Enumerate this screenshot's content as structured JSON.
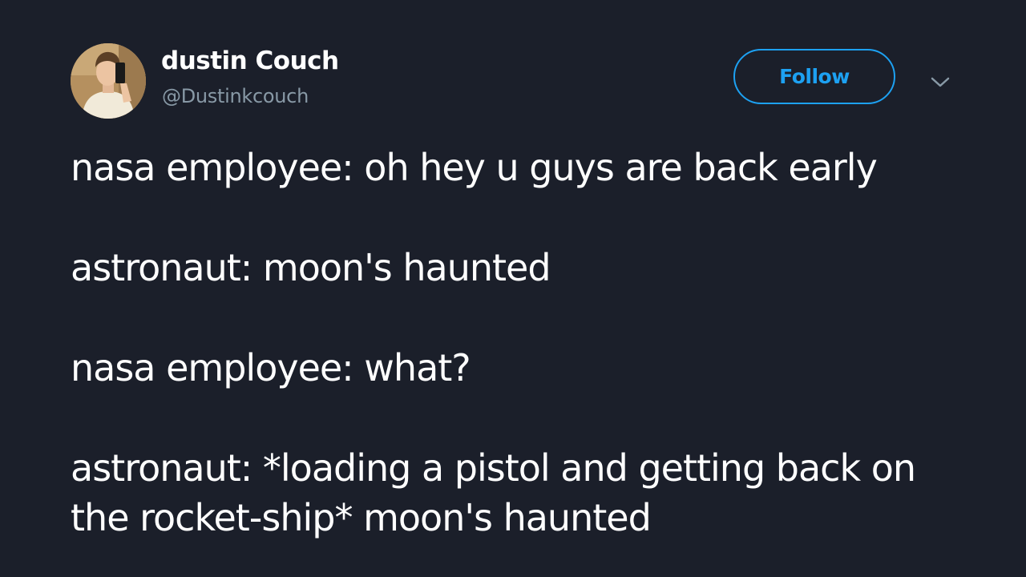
{
  "author": {
    "display_name": "dustin Couch",
    "handle": "@Dustinkcouch"
  },
  "actions": {
    "follow_label": "Follow",
    "more_icon": "chevron-down-icon"
  },
  "tweet": {
    "lines": [
      "nasa employee: oh hey u guys are back early",
      "astronaut: moon's haunted",
      "nasa employee: what?",
      "astronaut: *loading a pistol and getting back on the rocket-ship* moon's haunted"
    ]
  },
  "colors": {
    "background": "#1b1f2a",
    "accent": "#1da1f2",
    "secondary_text": "#8899a6",
    "primary_text": "#ffffff"
  }
}
